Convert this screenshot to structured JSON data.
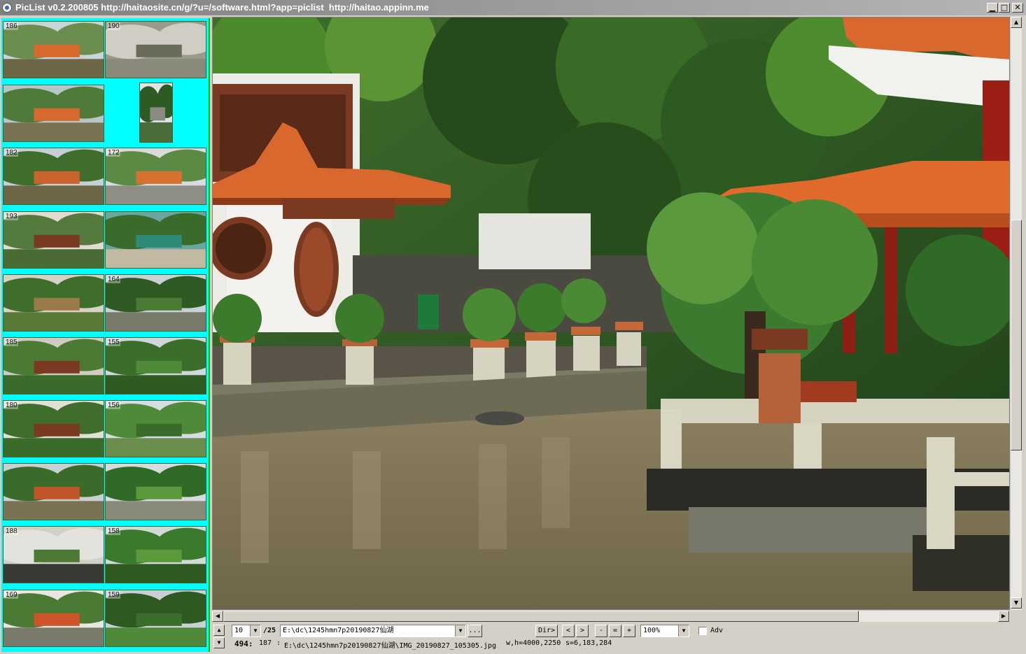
{
  "window": {
    "title": "PicList v0.2.200805 http://haitaosite.cn/g/?u=/software.html?app=piclist  http://haitao.appinn.me",
    "minimize_glyph": "▁",
    "maximize_glyph": "□",
    "close_glyph": "✕"
  },
  "thumbnails": [
    {
      "num": "186",
      "icon": "pavilion-pond-photo"
    },
    {
      "num": "190",
      "icon": "wall-rock-photo"
    },
    {
      "num": "",
      "icon": "pond-pavilion-photo"
    },
    {
      "num": "",
      "icon": "waterfall-photo"
    },
    {
      "num": "182",
      "icon": "lake-pavilion-photo"
    },
    {
      "num": "172",
      "icon": "pavilion-street-photo"
    },
    {
      "num": "193",
      "icon": "bonsai-photo"
    },
    {
      "num": "",
      "icon": "map-sign-photo"
    },
    {
      "num": "",
      "icon": "bonsai-rack-photo"
    },
    {
      "num": "164",
      "icon": "forest-road-photo"
    },
    {
      "num": "185",
      "icon": "bonsai-shelf-photo"
    },
    {
      "num": "155",
      "icon": "orchard-photo"
    },
    {
      "num": "180",
      "icon": "bonsai-stand-photo"
    },
    {
      "num": "156",
      "icon": "lake-trees-photo"
    },
    {
      "num": "",
      "icon": "lakeside-photo"
    },
    {
      "num": "",
      "icon": "green-path-photo"
    },
    {
      "num": "188",
      "icon": "bonsai-display-photo"
    },
    {
      "num": "158",
      "icon": "shrubs-photo"
    },
    {
      "num": "169",
      "icon": "garden-gate-photo"
    },
    {
      "num": "159",
      "icon": "tree-grove-photo"
    }
  ],
  "viewer": {
    "image_icon": "chinese-garden-pavilion-photo",
    "colors": {
      "water": "#7d7254",
      "sky": "#e9eef0",
      "roof": "#d9682e",
      "foliage": "#2f5a25",
      "accent": "#00ffff"
    }
  },
  "toolbar": {
    "page_value": "10",
    "page_total": "/25",
    "dir_path": "E:\\dc\\1245hmn7p20190827仙湖",
    "browse_label": "...",
    "dir_label": "Dir>",
    "prev_label": "<",
    "next_label": ">",
    "zoom_out_label": "-",
    "zoom_fit_label": "=",
    "zoom_in_label": "+",
    "zoom_value": "100%",
    "adv_label": "Adv"
  },
  "status": {
    "count": "494:",
    "index": "187",
    "sep": ":",
    "file_path": "E:\\dc\\1245hmn7p20190827仙湖\\IMG_20190827_105305.jpg",
    "dims": "w,h=4000,2250",
    "size": "s=6,183,284"
  }
}
